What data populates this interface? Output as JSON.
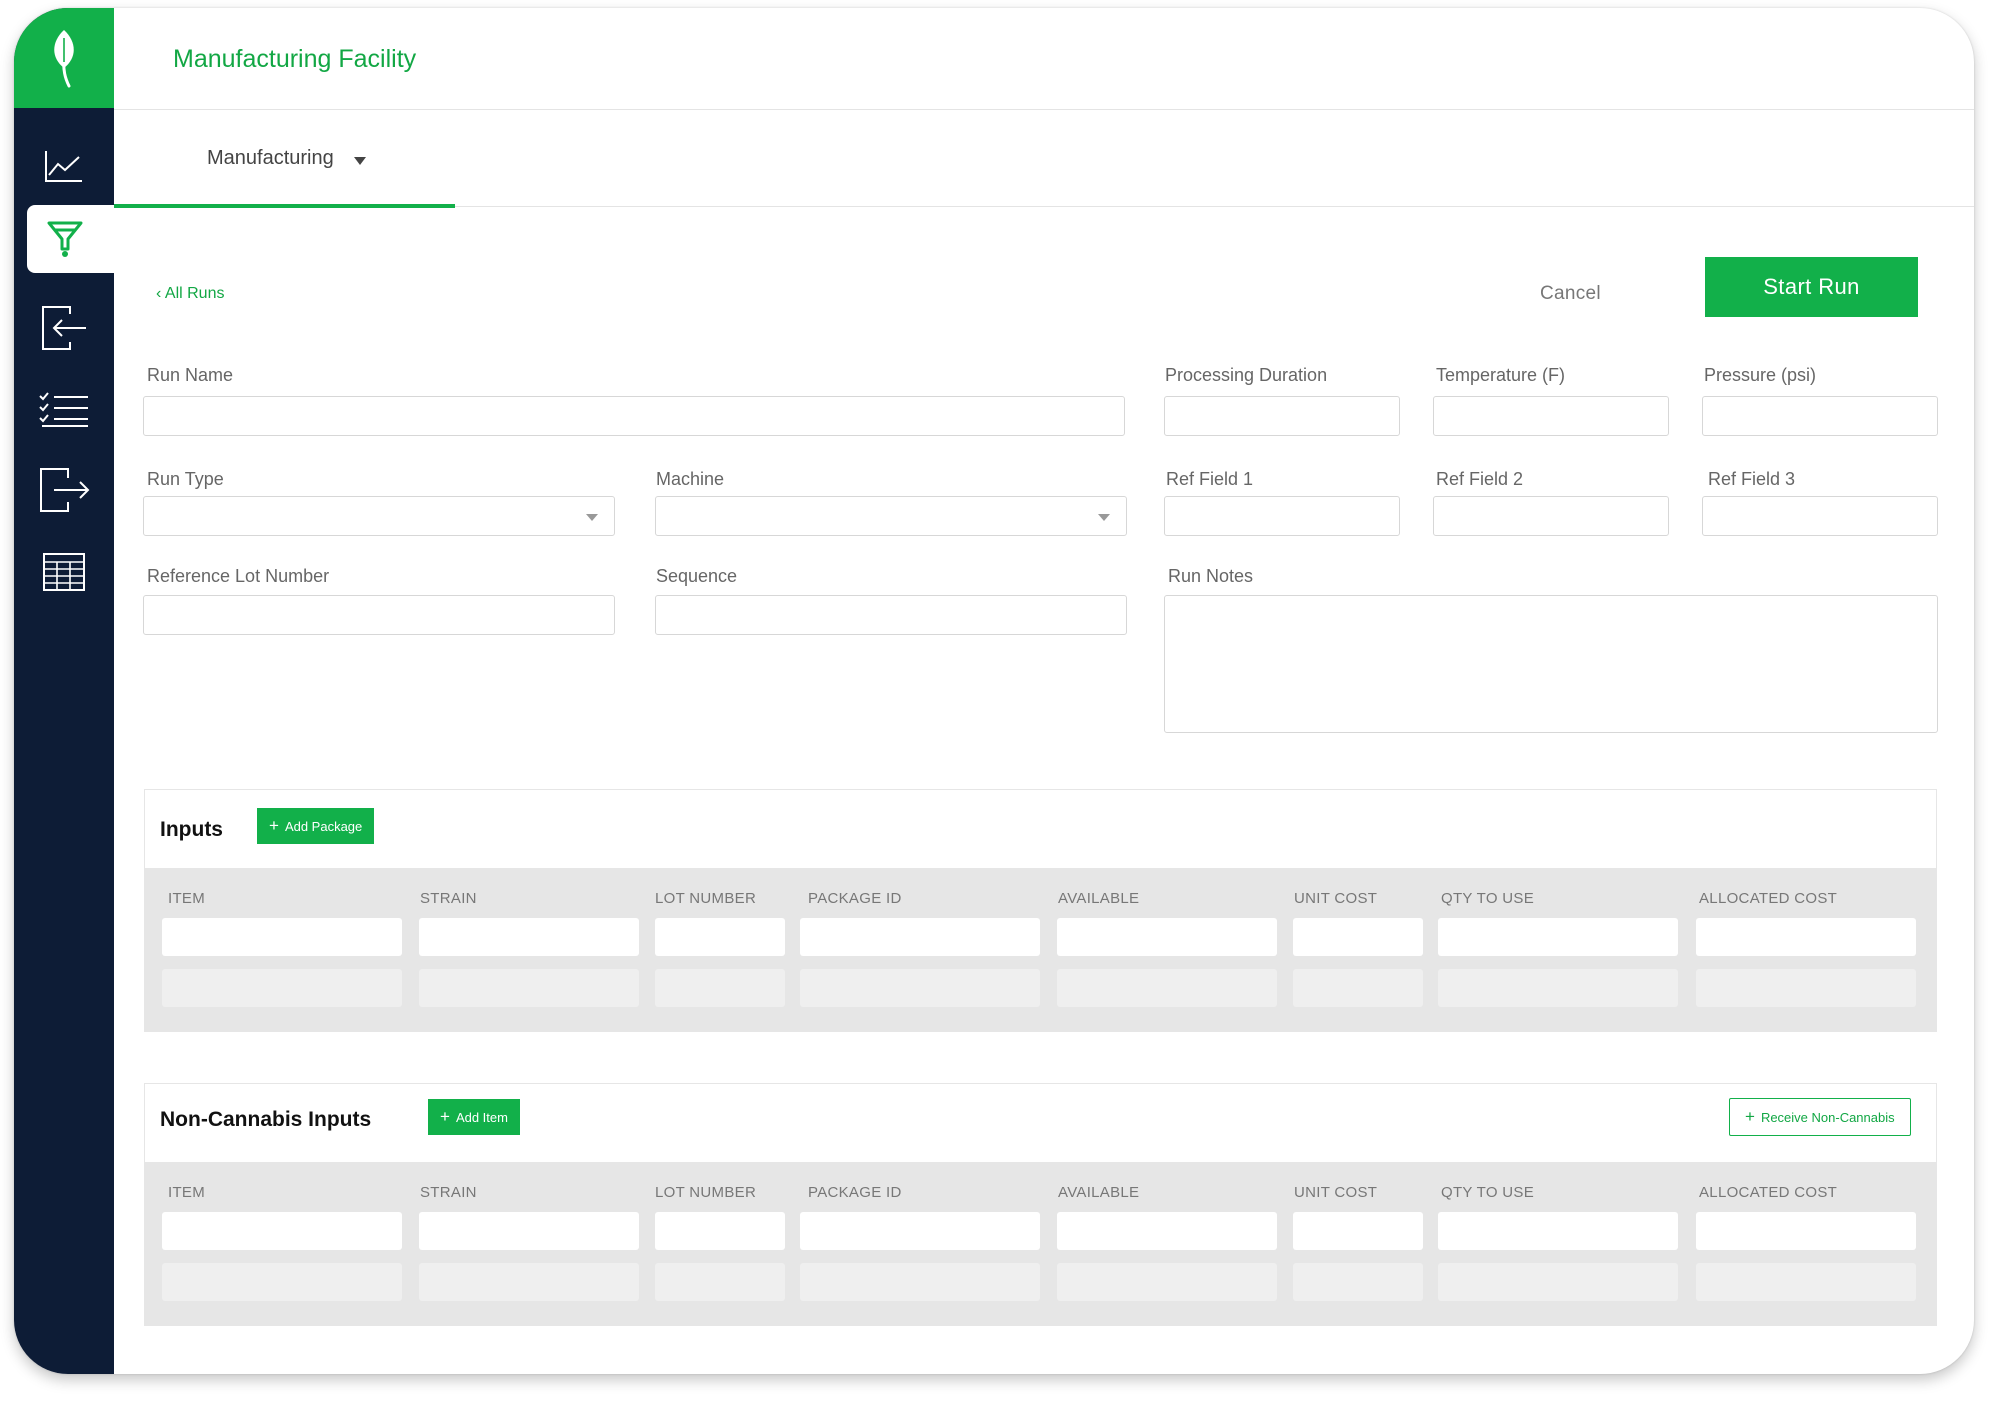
{
  "app": {
    "facility_title": "Manufacturing Facility"
  },
  "sidebar": {
    "items": [
      {
        "name": "analytics",
        "icon": "line-chart-icon"
      },
      {
        "name": "manufacturing",
        "icon": "funnel-icon",
        "active": true
      },
      {
        "name": "receive",
        "icon": "sign-in-icon"
      },
      {
        "name": "tasks",
        "icon": "checklist-icon"
      },
      {
        "name": "ship",
        "icon": "sign-out-icon"
      },
      {
        "name": "reports",
        "icon": "table-icon"
      }
    ]
  },
  "tabs": {
    "active_label": "Manufacturing"
  },
  "header": {
    "back_link": "‹ All Runs",
    "cancel_label": "Cancel",
    "start_label": "Start Run"
  },
  "form": {
    "run_name": {
      "label": "Run Name",
      "value": ""
    },
    "processing_duration": {
      "label": "Processing Duration",
      "value": ""
    },
    "temperature": {
      "label": "Temperature (F)",
      "value": ""
    },
    "pressure": {
      "label": "Pressure (psi)",
      "value": ""
    },
    "run_type": {
      "label": "Run Type",
      "value": ""
    },
    "machine": {
      "label": "Machine",
      "value": ""
    },
    "ref_field_1": {
      "label": "Ref Field 1",
      "value": ""
    },
    "ref_field_2": {
      "label": "Ref Field 2",
      "value": ""
    },
    "ref_field_3": {
      "label": "Ref Field 3",
      "value": ""
    },
    "reference_lot_number": {
      "label": "Reference Lot Number",
      "value": ""
    },
    "sequence": {
      "label": "Sequence",
      "value": ""
    },
    "run_notes": {
      "label": "Run Notes",
      "value": ""
    }
  },
  "inputs": {
    "title": "Inputs",
    "add_label": "Add Package",
    "columns": [
      "ITEM",
      "STRAIN",
      "LOT NUMBER",
      "PACKAGE ID",
      "AVAILABLE",
      "UNIT COST",
      "QTY TO USE",
      "ALLOCATED COST"
    ]
  },
  "non_cannabis": {
    "title": "Non-Cannabis Inputs",
    "add_label": "Add Item",
    "receive_label": "Receive Non-Cannabis",
    "columns": [
      "ITEM",
      "STRAIN",
      "LOT NUMBER",
      "PACKAGE ID",
      "AVAILABLE",
      "UNIT COST",
      "QTY TO USE",
      "ALLOCATED COST"
    ]
  },
  "colors": {
    "accent": "#12b04a",
    "sidebar": "#0d1c36",
    "table_bg": "#e6e6e6"
  }
}
